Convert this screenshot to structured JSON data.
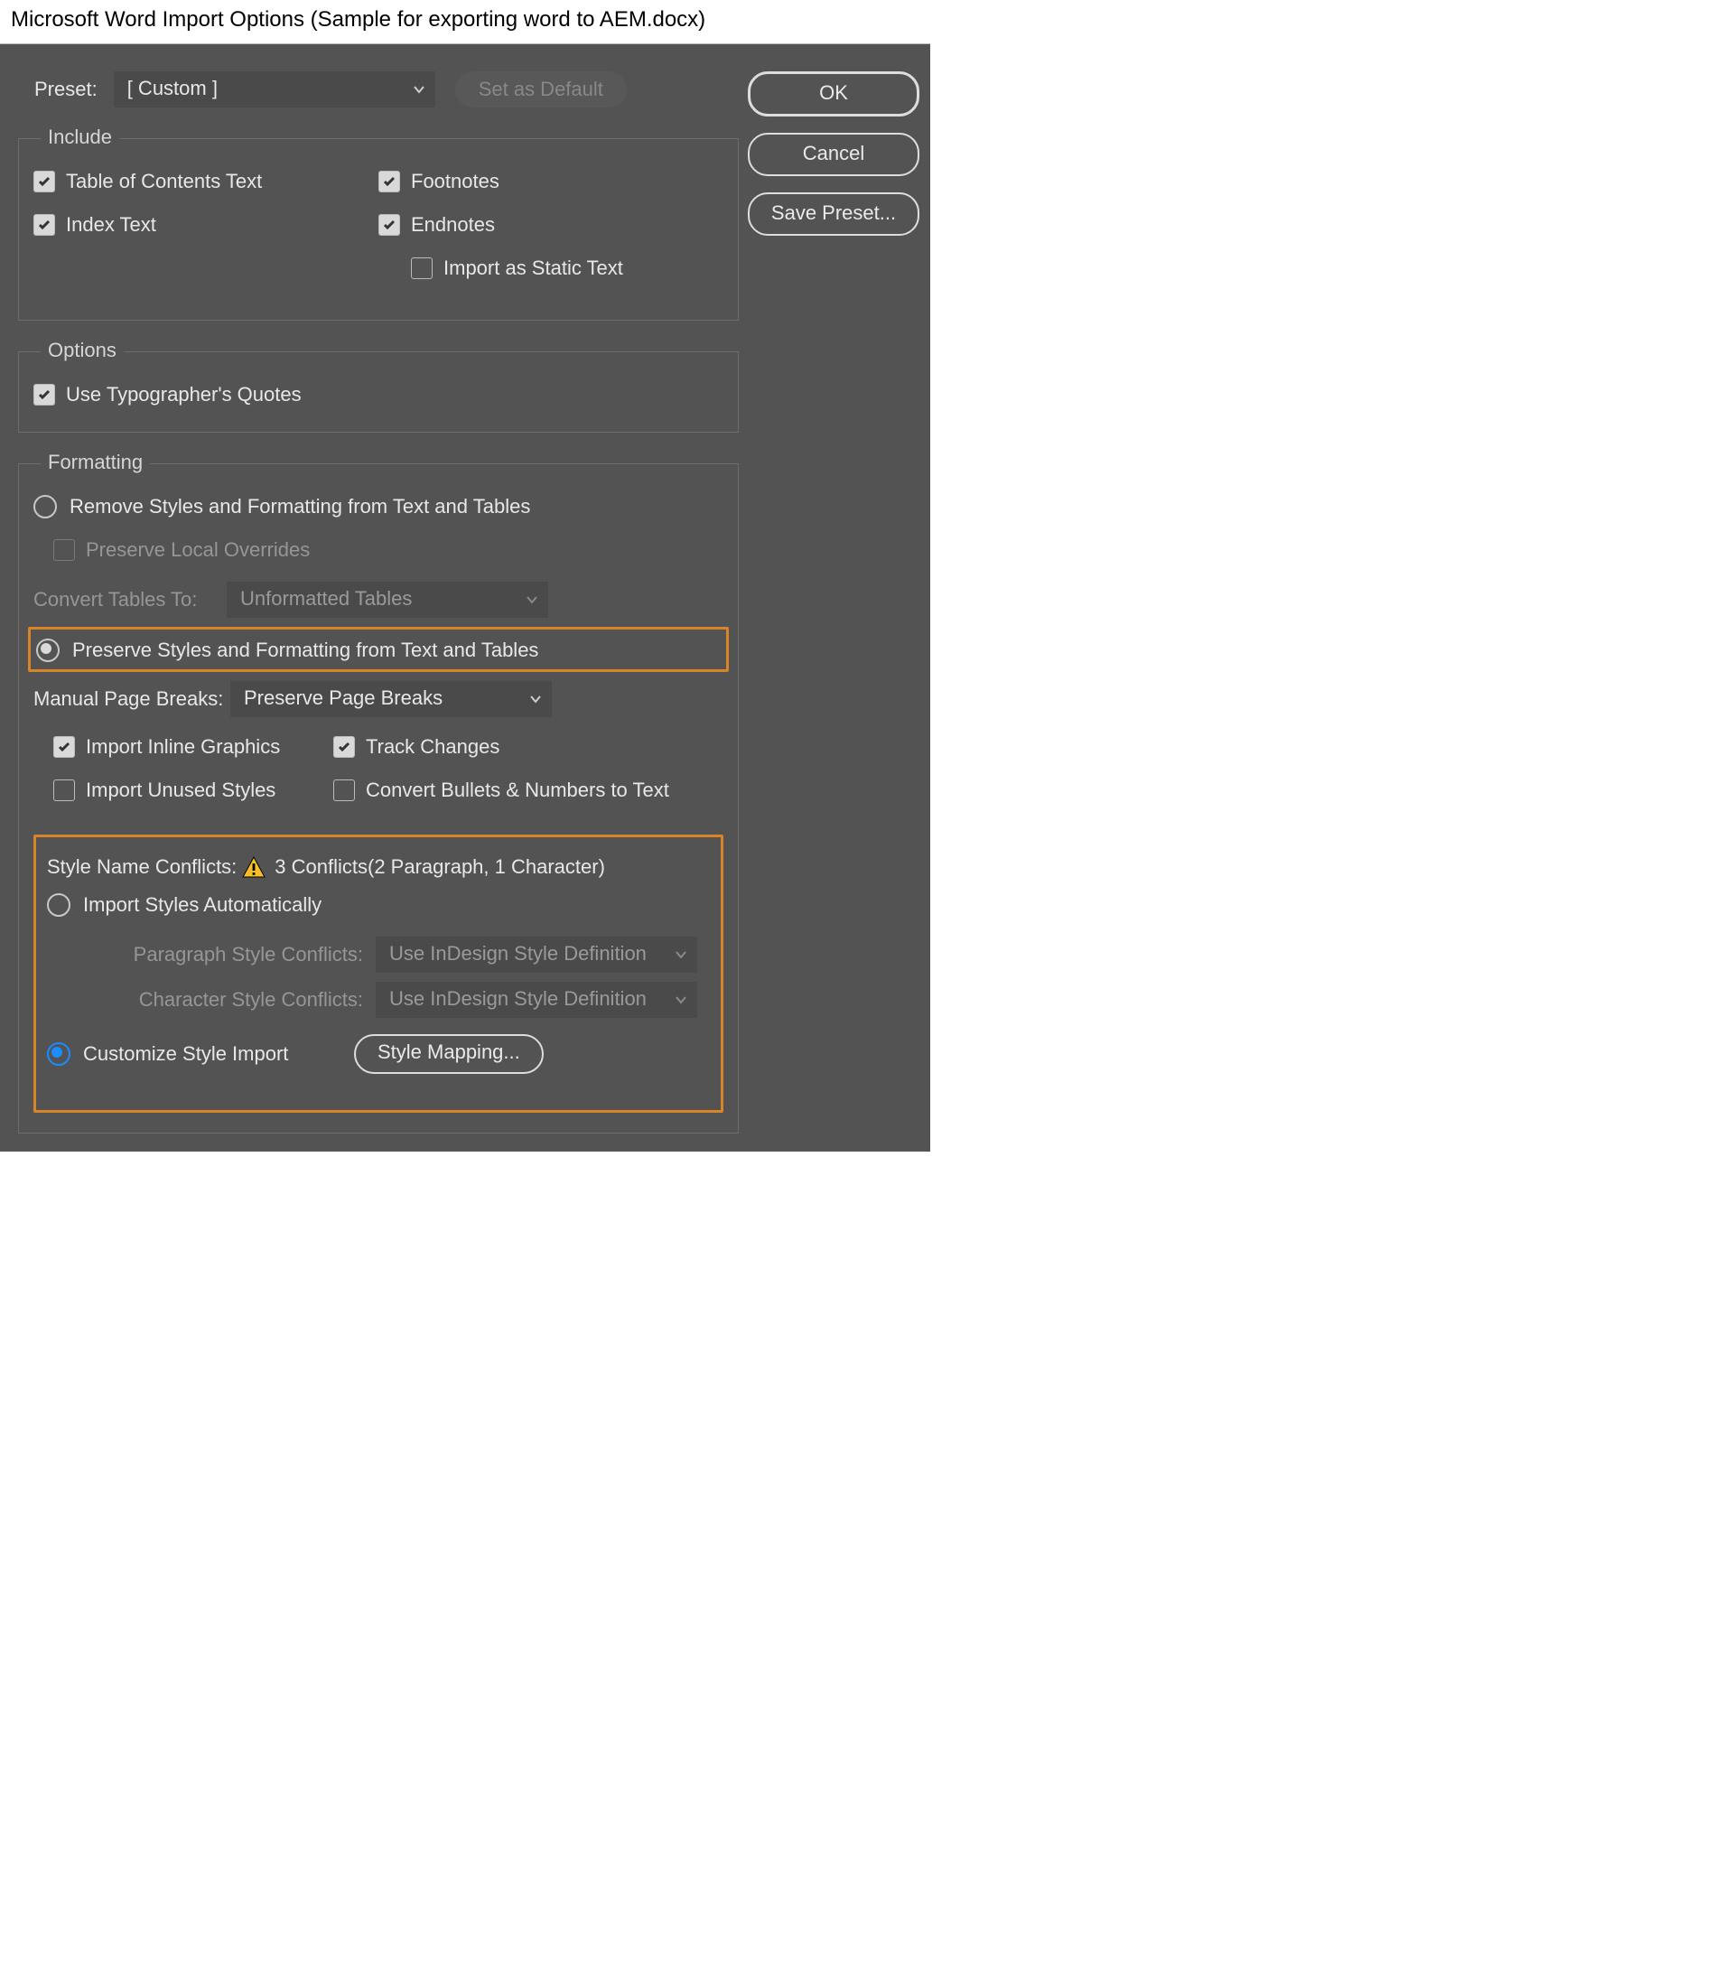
{
  "title": "Microsoft Word Import Options (Sample for exporting word to AEM.docx)",
  "preset": {
    "label": "Preset:",
    "value": "[ Custom ]"
  },
  "set_default": "Set as Default",
  "buttons": {
    "ok": "OK",
    "cancel": "Cancel",
    "save_preset": "Save Preset..."
  },
  "include": {
    "legend": "Include",
    "toc": "Table of Contents Text",
    "index": "Index Text",
    "footnotes": "Footnotes",
    "endnotes": "Endnotes",
    "static": "Import as Static Text"
  },
  "options": {
    "legend": "Options",
    "typographer": "Use Typographer's Quotes"
  },
  "formatting": {
    "legend": "Formatting",
    "remove": "Remove Styles and Formatting from Text and Tables",
    "preserve_local": "Preserve Local Overrides",
    "convert_tables_label": "Convert Tables To:",
    "convert_tables_value": "Unformatted Tables",
    "preserve": "Preserve Styles and Formatting from Text and Tables",
    "manual_breaks_label": "Manual Page Breaks:",
    "manual_breaks_value": "Preserve Page Breaks",
    "inline_graphics": "Import Inline Graphics",
    "track_changes": "Track Changes",
    "unused_styles": "Import Unused Styles",
    "convert_bullets": "Convert Bullets & Numbers to Text"
  },
  "conflicts": {
    "label": "Style Name Conflicts:",
    "text": "3 Conflicts(2 Paragraph, 1 Character)",
    "import_auto": "Import Styles Automatically",
    "para_label": "Paragraph Style Conflicts:",
    "para_value": "Use InDesign Style Definition",
    "char_label": "Character Style Conflicts:",
    "char_value": "Use InDesign Style Definition",
    "customize": "Customize Style Import",
    "mapping": "Style Mapping..."
  }
}
